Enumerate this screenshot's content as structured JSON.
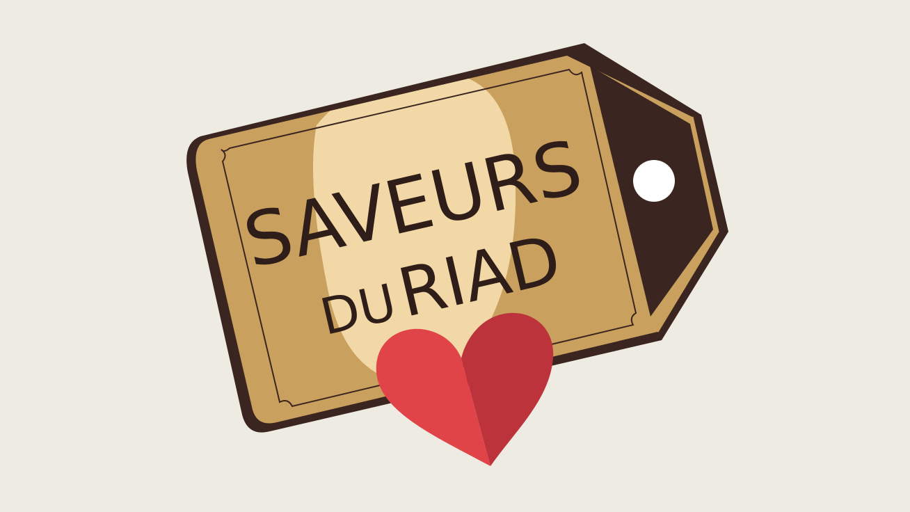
{
  "logo": {
    "line1": "SAVEURS",
    "line2_small": "DU",
    "line2_large": "RIAD"
  },
  "colors": {
    "background": "#eeece2",
    "tag_outline": "#3a2520",
    "tag_gold": "#c9a05d",
    "tag_highlight": "#f1d8a6",
    "tag_tip": "#3a2520",
    "heart_left": "#e04448",
    "heart_right": "#bd333c",
    "text": "#2e1d18"
  },
  "icons": [
    "price-tag-icon",
    "heart-icon"
  ]
}
